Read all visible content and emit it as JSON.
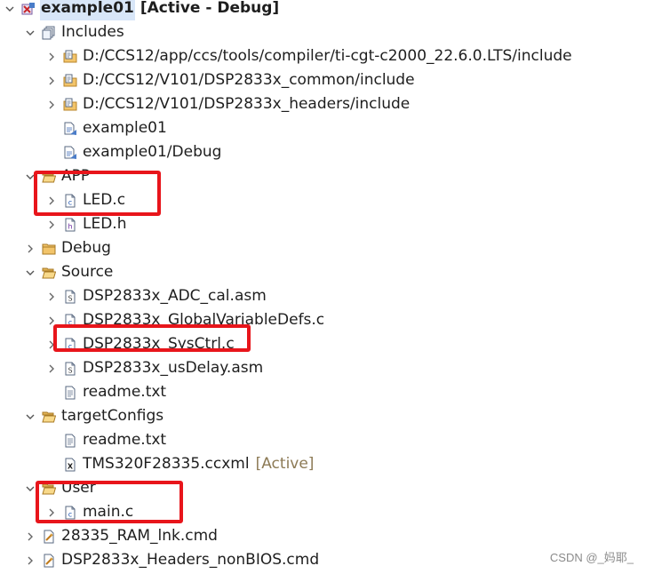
{
  "project": {
    "name": "example01",
    "status": "[Active - Debug]"
  },
  "tree": [
    {
      "label": "example01",
      "suffix": "[Active - Debug]",
      "icon": "project-icon",
      "chevron": "down",
      "indent": 0,
      "bold": true,
      "selected": true
    },
    {
      "label": "Includes",
      "icon": "includes-icon",
      "chevron": "down",
      "indent": 1
    },
    {
      "label": "D:/CCS12/app/ccs/tools/compiler/ti-cgt-c2000_22.6.0.LTS/include",
      "icon": "include-folder-icon",
      "chevron": "right",
      "indent": 2
    },
    {
      "label": "D:/CCS12/V101/DSP2833x_common/include",
      "icon": "include-folder-icon",
      "chevron": "right",
      "indent": 2
    },
    {
      "label": "D:/CCS12/V101/DSP2833x_headers/include",
      "icon": "include-folder-icon",
      "chevron": "right",
      "indent": 2
    },
    {
      "label": "example01",
      "icon": "include-path-icon",
      "chevron": "none",
      "indent": 2
    },
    {
      "label": "example01/Debug",
      "icon": "include-path-icon",
      "chevron": "none",
      "indent": 2
    },
    {
      "label": "APP",
      "icon": "folder-open-icon",
      "chevron": "down",
      "indent": 1
    },
    {
      "label": "LED.c",
      "icon": "c-file-icon",
      "chevron": "right",
      "indent": 2
    },
    {
      "label": "LED.h",
      "icon": "h-file-icon",
      "chevron": "right",
      "indent": 2
    },
    {
      "label": "Debug",
      "icon": "folder-icon",
      "chevron": "right",
      "indent": 1
    },
    {
      "label": "Source",
      "icon": "folder-open-icon",
      "chevron": "down",
      "indent": 1
    },
    {
      "label": "DSP2833x_ADC_cal.asm",
      "icon": "asm-file-icon",
      "chevron": "right",
      "indent": 2
    },
    {
      "label": "DSP2833x_GlobalVariableDefs.c",
      "icon": "c-file-icon",
      "chevron": "right",
      "indent": 2
    },
    {
      "label": "DSP2833x_SysCtrl.c",
      "icon": "c-file-icon",
      "chevron": "right",
      "indent": 2
    },
    {
      "label": "DSP2833x_usDelay.asm",
      "icon": "asm-file-icon",
      "chevron": "right",
      "indent": 2
    },
    {
      "label": "readme.txt",
      "icon": "text-file-icon",
      "chevron": "none",
      "indent": 2
    },
    {
      "label": "targetConfigs",
      "icon": "folder-open-icon",
      "chevron": "down",
      "indent": 1
    },
    {
      "label": "readme.txt",
      "icon": "text-file-icon",
      "chevron": "none",
      "indent": 2
    },
    {
      "label": "TMS320F28335.ccxml",
      "suffix": "[Active]",
      "icon": "ccxml-file-icon",
      "chevron": "none",
      "indent": 2
    },
    {
      "label": "User",
      "icon": "folder-open-icon",
      "chevron": "down",
      "indent": 1
    },
    {
      "label": "main.c",
      "icon": "c-file-icon",
      "chevron": "right",
      "indent": 2
    },
    {
      "label": "28335_RAM_lnk.cmd",
      "icon": "cmd-file-icon",
      "chevron": "right",
      "indent": 1
    },
    {
      "label": "DSP2833x_Headers_nonBIOS.cmd",
      "icon": "cmd-file-icon",
      "chevron": "right",
      "indent": 1
    }
  ],
  "highlights": [
    "LED.c",
    "DSP2833x_SysCtrl.c",
    "main.c"
  ],
  "colors": {
    "highlight_box": "#e8151b",
    "selection": "#d8e6f8",
    "suffix_text": "#8c7a55"
  },
  "watermark": "CSDN @_妈耶_"
}
